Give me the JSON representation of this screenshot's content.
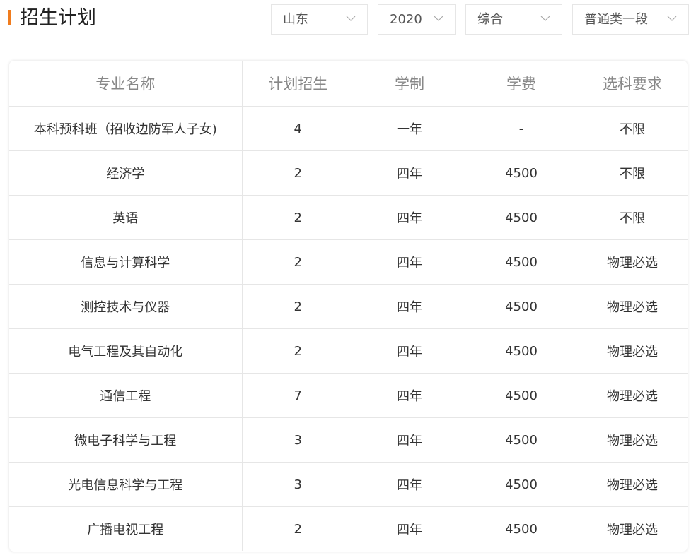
{
  "header": {
    "title": "招生计划"
  },
  "filters": {
    "province": "山东",
    "year": "2020",
    "subject": "综合",
    "batch": "普通类一段"
  },
  "table": {
    "headers": [
      "专业名称",
      "计划招生",
      "学制",
      "学费",
      "选科要求"
    ],
    "rows": [
      [
        "本科预科班（招收边防军人子女)",
        "4",
        "一年",
        "-",
        "不限"
      ],
      [
        "经济学",
        "2",
        "四年",
        "4500",
        "不限"
      ],
      [
        "英语",
        "2",
        "四年",
        "4500",
        "不限"
      ],
      [
        "信息与计算科学",
        "2",
        "四年",
        "4500",
        "物理必选"
      ],
      [
        "测控技术与仪器",
        "2",
        "四年",
        "4500",
        "物理必选"
      ],
      [
        "电气工程及其自动化",
        "2",
        "四年",
        "4500",
        "物理必选"
      ],
      [
        "通信工程",
        "7",
        "四年",
        "4500",
        "物理必选"
      ],
      [
        "微电子科学与工程",
        "3",
        "四年",
        "4500",
        "物理必选"
      ],
      [
        "光电信息科学与工程",
        "3",
        "四年",
        "4500",
        "物理必选"
      ],
      [
        "广播电视工程",
        "2",
        "四年",
        "4500",
        "物理必选"
      ]
    ]
  },
  "colors": {
    "accent": "#f07c1e",
    "border": "#e6e6e6",
    "header_text": "#888888",
    "body_text": "#333333"
  },
  "icons": {
    "dropdown": "chevron-down-icon"
  }
}
